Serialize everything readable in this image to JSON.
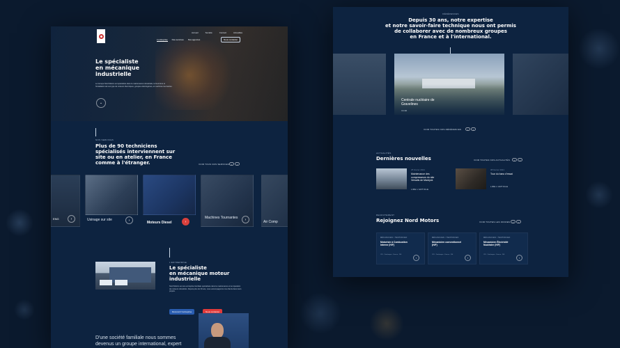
{
  "left": {
    "nav": {
      "links": [
        "Accueil",
        "Société",
        "Contact",
        "Actualités"
      ],
      "cta": [
        "L'entreprise",
        "Nos services",
        "Nos agences"
      ],
      "contact": "Nous contacter"
    },
    "hero": {
      "title_lines": [
        "Le spécialiste",
        "en mécanique",
        "industrielle"
      ],
      "text": "Le Groupe Nord Motors est spécialiste dans la maintenance industrielle, la fourniture et l'installation de tout type de moteurs thermiques, groupes électrogènes, et machines tournantes."
    },
    "services": {
      "eyebrow": "Nos services",
      "title_lines": [
        "Plus de 90 techniciens",
        "spécialisés interviennent sur",
        "site ou en atelier, en France",
        "comme à l'étranger."
      ],
      "see_all": "Voir tous nos services",
      "cards": [
        "ENG",
        "Usinage sur site",
        "Moteurs Diesel",
        "Machines Tournantes",
        "Air Comp"
      ]
    },
    "company": {
      "eyebrow": "L'entreprise",
      "title_lines": [
        "Le spécialiste",
        "en mécanique moteur",
        "industrielle"
      ],
      "text": "Nord Motors est une entreprise familiale spécialisée dans la maintenance et la réparation de moteurs industriels. Depuis plus de 30 ans, nous accompagnons nos clients dans leurs projets.",
      "btn_blue": "Découvrir l'entreprise",
      "btn_red": "Nous contacter"
    },
    "family": {
      "text_lines": [
        "D'une société familiale nous sommes",
        "devenus un groupe international, expert"
      ]
    }
  },
  "right": {
    "refs": {
      "eyebrow": "Références",
      "title_lines": [
        "Depuis 30 ans, notre expertise",
        "et notre savoir-faire technique nous ont permis",
        "de collaborer avec de nombreux groupes",
        "en France et à l'international."
      ],
      "card_title_lines": [
        "Centrale nucléaire de",
        "Gravelines"
      ],
      "card_link": "Voir",
      "see_all": "Voir toutes nos références"
    },
    "news": {
      "eyebrow": "Actualités",
      "title": "Dernières nouvelles",
      "see_all": "Voir toutes nos actualités",
      "items": [
        {
          "date": "25 février 2021",
          "title_lines": [
            "Maintenance des",
            "compresseurs du site",
            "Versalis de Mardyck"
          ],
          "link": "Lire l'article"
        },
        {
          "date": "08 février 2021",
          "title_lines": [
            "Tour du banc d'essai"
          ],
          "link": "Lire l'article"
        }
      ]
    },
    "jobs": {
      "eyebrow": "Recrutement",
      "title": "Rejoignez Nord Motors",
      "see_all": "Voir toutes les offres",
      "items": [
        {
          "tag": "Mécanicien / Technicien",
          "title_lines": [
            "Motoriste à Combustion",
            "Interne (H/F)"
          ],
          "meta": "CDI · Dunkerque · France · NS"
        },
        {
          "tag": "Mécanicien / Technicien",
          "title_lines": [
            "Mécanicien conventionnel",
            "(H/F)"
          ],
          "meta": "CDI · Dunkerque · France · NS"
        },
        {
          "tag": "Mécanicien / Technicien",
          "title_lines": [
            "Mécanicien Électricité",
            "Nucléaire (H/F)"
          ],
          "meta": "CDI · Dunkerque · France · NS"
        }
      ]
    }
  },
  "colors": {
    "bg": "#0b1a2e",
    "page": "#0d2340",
    "blue_btn": "#2a5db0",
    "red_btn": "#e23a3a",
    "accent_red": "#d9403c"
  }
}
